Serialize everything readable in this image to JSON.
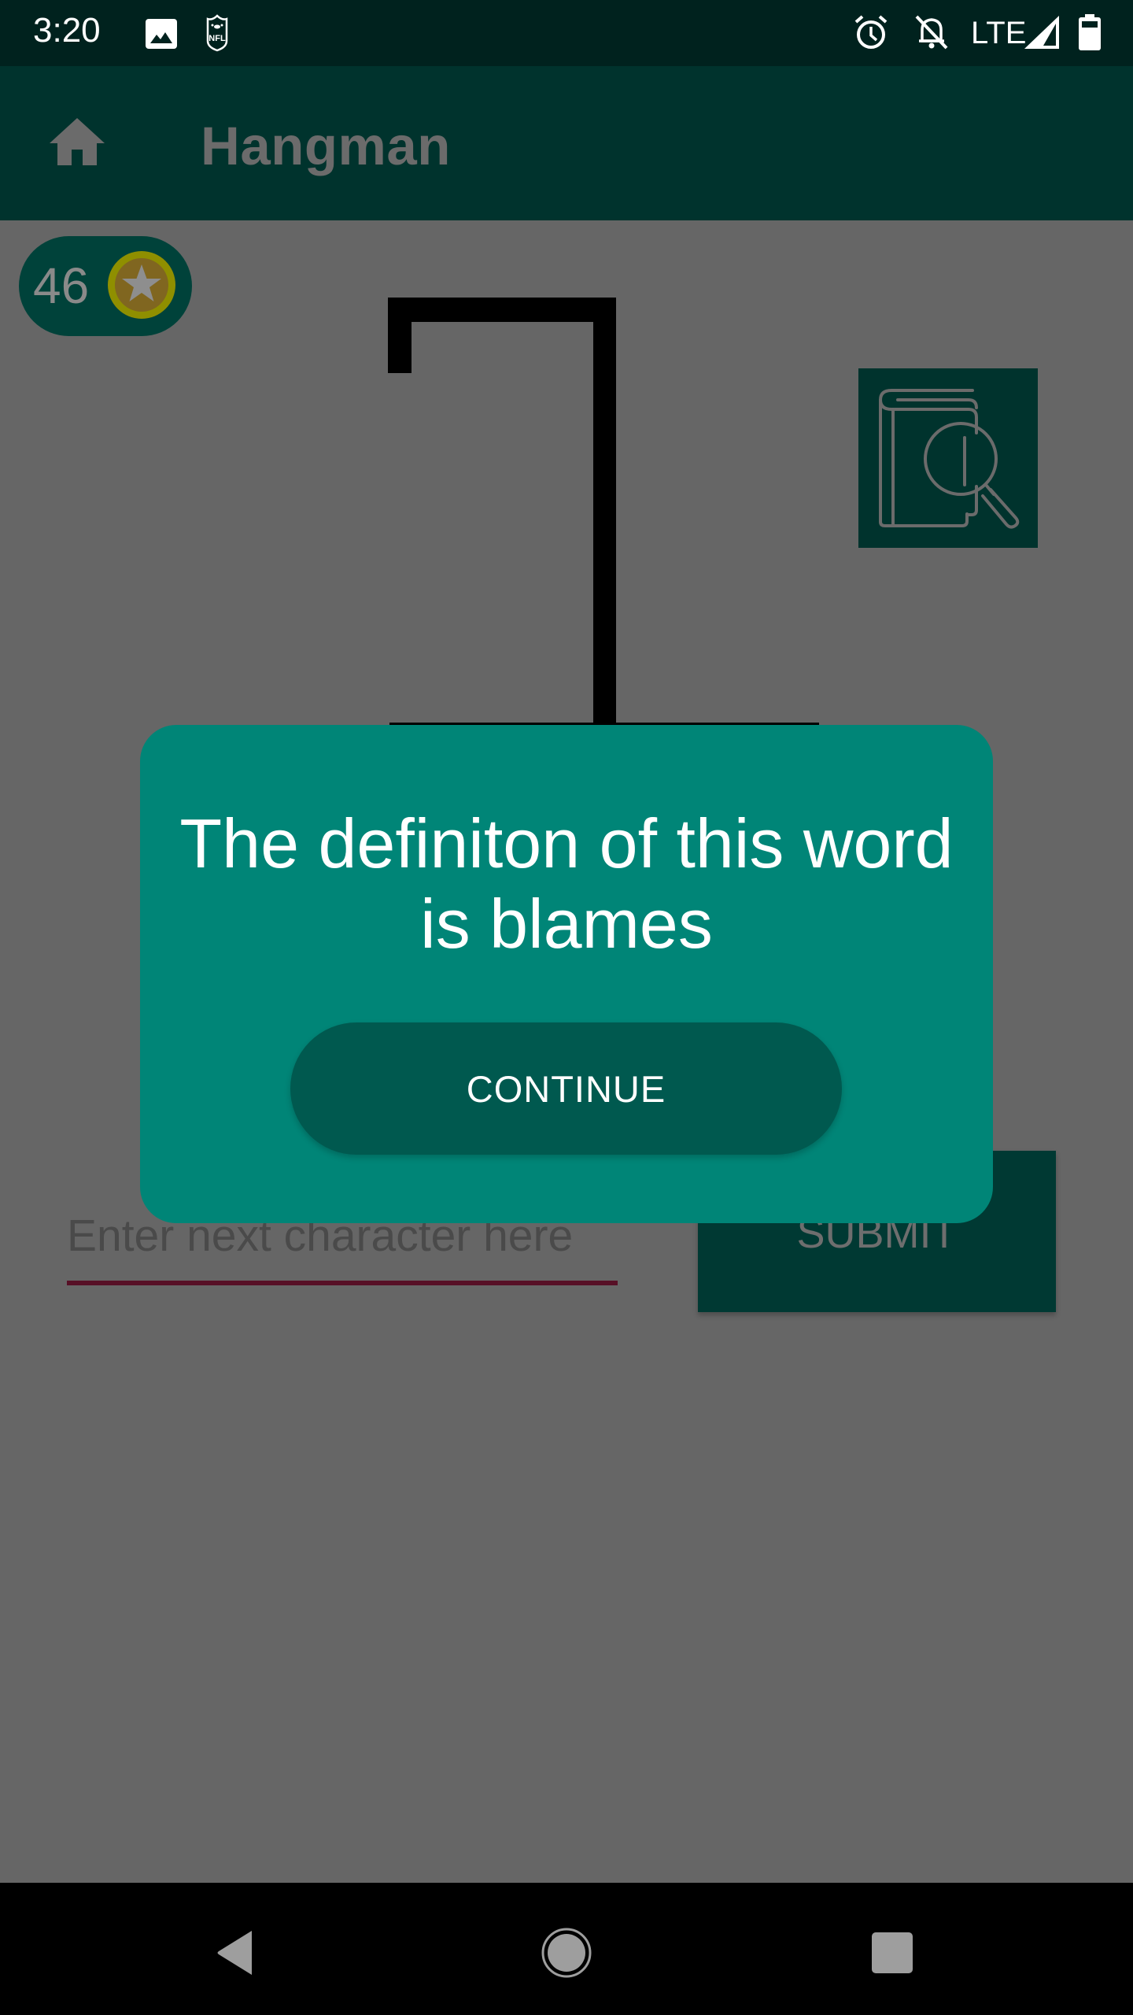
{
  "status_bar": {
    "time": "3:20",
    "network": "LTE",
    "icons": [
      "image-notification-icon",
      "nfl-app-icon",
      "alarm-icon",
      "notifications-off-icon",
      "signal-icon",
      "battery-icon"
    ]
  },
  "app_bar": {
    "title": "Hangman",
    "home_icon": "home-icon"
  },
  "game": {
    "coins": "46",
    "coin_icon": "star-coin-icon",
    "dictionary_icon": "book-magnifier-icon",
    "input": {
      "value": "",
      "placeholder": "Enter next character here"
    },
    "submit_label": "SUBMIT"
  },
  "dialog": {
    "message": "The definiton of this word is blames",
    "continue_label": "CONTINUE"
  },
  "nav_bar": {
    "buttons": [
      "back",
      "home",
      "recents"
    ]
  },
  "colors": {
    "status_bar": "#00221e",
    "app_bar": "#00332d",
    "scrim_background": "#666666",
    "dialog": "#008577",
    "dialog_button": "#00594f",
    "submit_button": "#003933",
    "input_underline": "#571026"
  }
}
